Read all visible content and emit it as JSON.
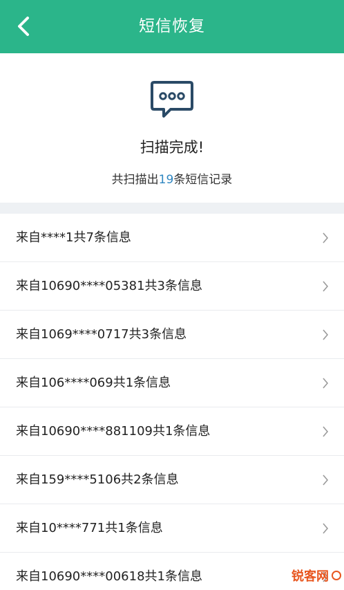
{
  "header": {
    "title": "短信恢复",
    "back_icon": "chevron-left-icon"
  },
  "summary": {
    "icon": "message-bubble-icon",
    "status": "扫描完成!",
    "count_prefix": "共扫描出",
    "count": "19",
    "count_suffix": "条短信记录"
  },
  "list": {
    "items": [
      {
        "label": "来自****1共7条信息"
      },
      {
        "label": "来自10690****05381共3条信息"
      },
      {
        "label": "来自1069****0717共3条信息"
      },
      {
        "label": "来自106****069共1条信息"
      },
      {
        "label": "来自10690****881109共1条信息"
      },
      {
        "label": "来自159****5106共2条信息"
      },
      {
        "label": "来自10****771共1条信息"
      },
      {
        "label": "来自10690****00618共1条信息"
      }
    ],
    "chevron_icon": "chevron-right-icon"
  },
  "watermark": {
    "text": "锐客网"
  },
  "colors": {
    "accent": "#2bb58a",
    "count_highlight": "#2e86c1",
    "icon_blue": "#2a4a66"
  }
}
